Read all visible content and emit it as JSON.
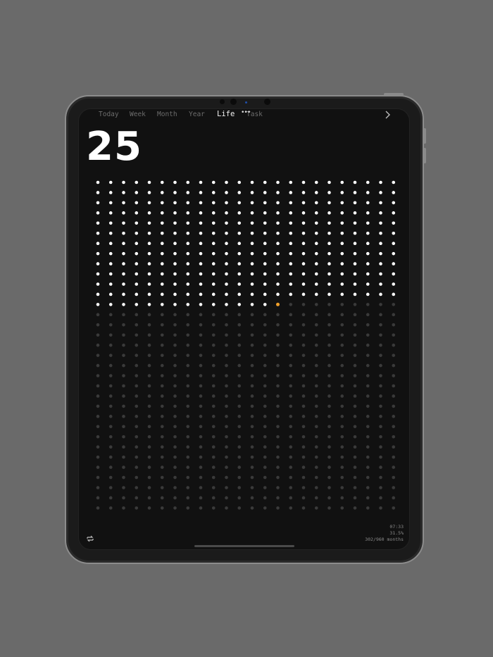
{
  "tabs": [
    {
      "label": "Today",
      "active": false
    },
    {
      "label": "Week",
      "active": false
    },
    {
      "label": "Month",
      "active": false
    },
    {
      "label": "Year",
      "active": false
    },
    {
      "label": "Life",
      "active": true
    },
    {
      "label": "Task",
      "active": false
    }
  ],
  "header": {
    "more_icon": "ellipsis-icon",
    "next_icon": "chevron-right-icon"
  },
  "life": {
    "big_number": "25",
    "grid": {
      "columns": 24,
      "rows": 33,
      "filled": 302,
      "current_index": 302
    },
    "colors": {
      "filled": "#ffffff",
      "current": "#f0a02a",
      "remaining": "#3a3a3a"
    }
  },
  "stats": {
    "time": "07:33",
    "percent": "31.5%",
    "months": "302/960 months"
  },
  "footer": {
    "refresh_icon": "refresh-icon"
  }
}
